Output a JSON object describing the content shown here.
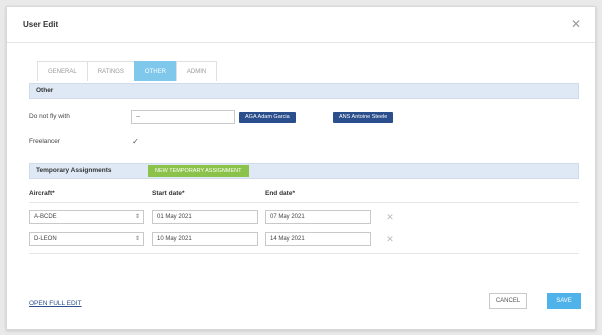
{
  "modal": {
    "title": "User Edit",
    "close_icon": "close-icon"
  },
  "tabs": [
    {
      "label": "GENERAL",
      "active": false
    },
    {
      "label": "RATINGS",
      "active": false
    },
    {
      "label": "OTHER",
      "active": true
    },
    {
      "label": "ADMIN",
      "active": false
    }
  ],
  "other": {
    "section_title": "Other",
    "do_not_fly_label": "Do not fly with",
    "do_not_fly_input": "--",
    "do_not_fly_tags": [
      "AGA Adam Garcia",
      "ANS Antoine Steele"
    ],
    "freelancer_label": "Freelancer",
    "freelancer_checked": true
  },
  "temporary": {
    "section_title": "Temporary Assignments",
    "new_button": "NEW TEMPORARY ASSIGNMENT",
    "columns": [
      "Aircraft*",
      "Start date*",
      "End date*"
    ],
    "rows": [
      {
        "aircraft": "A-BCDE",
        "start": "01 May 2021",
        "end": "07 May 2021"
      },
      {
        "aircraft": "D-LEON",
        "start": "10 May 2021",
        "end": "14 May 2021"
      }
    ]
  },
  "footer": {
    "open_full_edit": "OPEN FULL EDIT",
    "cancel": "CANCEL",
    "save": "SAVE"
  },
  "colors": {
    "tab_active": "#7fc8ec",
    "tag_bg": "#2b4e8c",
    "green_button": "#8bc34a",
    "save_button": "#4fb3ea",
    "section_bar": "#dfe9f5"
  }
}
